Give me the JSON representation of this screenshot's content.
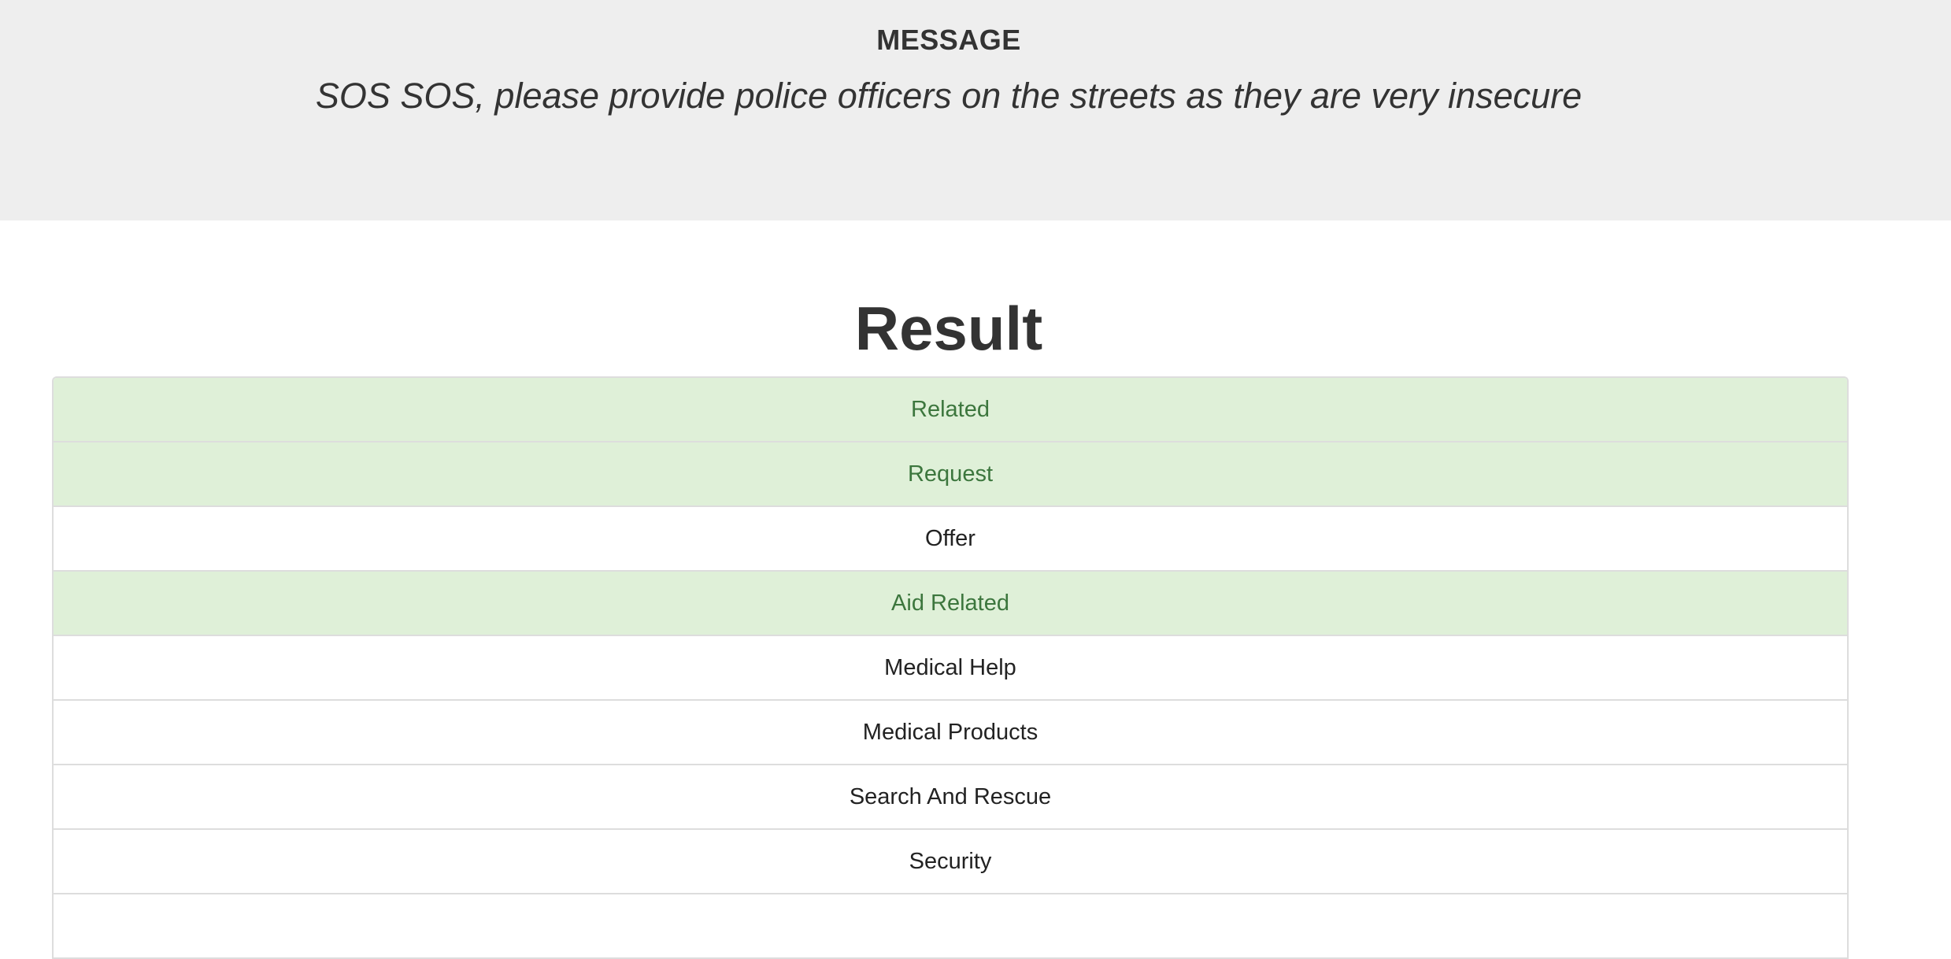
{
  "message": {
    "heading": "MESSAGE",
    "text": "SOS SOS, please provide police officers on the streets as they are very insecure"
  },
  "result": {
    "title": "Result",
    "categories": [
      {
        "label": "Related",
        "active": true
      },
      {
        "label": "Request",
        "active": true
      },
      {
        "label": "Offer",
        "active": false
      },
      {
        "label": "Aid Related",
        "active": true
      },
      {
        "label": "Medical Help",
        "active": false
      },
      {
        "label": "Medical Products",
        "active": false
      },
      {
        "label": "Search And Rescue",
        "active": false
      },
      {
        "label": "Security",
        "active": false
      },
      {
        "label": "",
        "active": false
      }
    ]
  },
  "colors": {
    "active_background": "#dff0d8",
    "active_text": "#3c763d",
    "jumbotron_background": "#eeeeee"
  }
}
